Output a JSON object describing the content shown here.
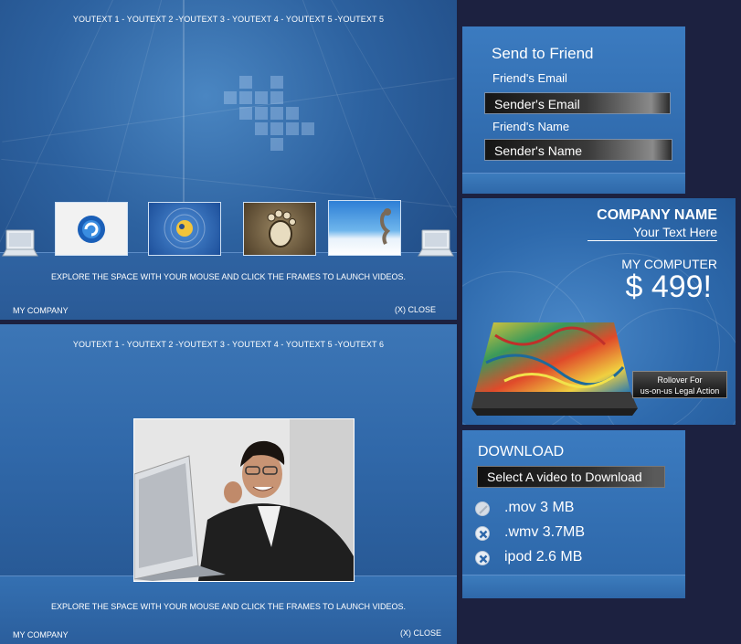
{
  "player_top": {
    "nav_text": "YOUTEXT 1 - YOUTEXT 2 -YOUTEXT 3 - YOUTEXT 4 - YOUTEXT 5 -YOUTEXT 5",
    "instruction": "EXPLORE THE SPACE WITH YOUR MOUSE AND CLICK THE FRAMES TO LAUNCH VIDEOS.",
    "company": "MY COMPANY",
    "close": "(X) CLOSE",
    "thumbnails": [
      {
        "name": "thumb-swirl-logo"
      },
      {
        "name": "thumb-gnome-logo"
      },
      {
        "name": "thumb-footprint"
      },
      {
        "name": "thumb-seahorse"
      }
    ]
  },
  "player_bottom": {
    "nav_text": "YOUTEXT 1 - YOUTEXT 2 -YOUTEXT 3 - YOUTEXT 4 - YOUTEXT 5 -YOUTEXT 6",
    "instruction": "EXPLORE THE SPACE WITH YOUR MOUSE AND CLICK THE FRAMES TO LAUNCH VIDEOS.",
    "company": "MY COMPANY",
    "close": "(X) CLOSE"
  },
  "send_friend": {
    "title": "Send to Friend",
    "friend_email_label": "Friend's Email",
    "sender_email": "Sender's Email",
    "friend_name_label": "Friend's Name",
    "sender_name": "Sender's Name"
  },
  "ad": {
    "company_name": "COMPANY NAME",
    "tagline": "Your Text Here",
    "product": "MY COMPUTER",
    "price": "$ 499!",
    "rollover_line1": "Rollover For",
    "rollover_line2": "us-on-us Legal Action"
  },
  "download": {
    "title": "DOWNLOAD",
    "select_label": "Select A video to Download",
    "items": [
      {
        "label": ".mov 3 MB",
        "icon": "disabled-circle-icon"
      },
      {
        "label": ".wmv 3.7MB",
        "icon": "x-circle-icon"
      },
      {
        "label": "ipod 2.6 MB",
        "icon": "x-circle-icon"
      }
    ]
  },
  "colors": {
    "page_bg": "#1c2140",
    "panel_blue": "#2e68aa",
    "dark_field": "#1a1a1a"
  }
}
